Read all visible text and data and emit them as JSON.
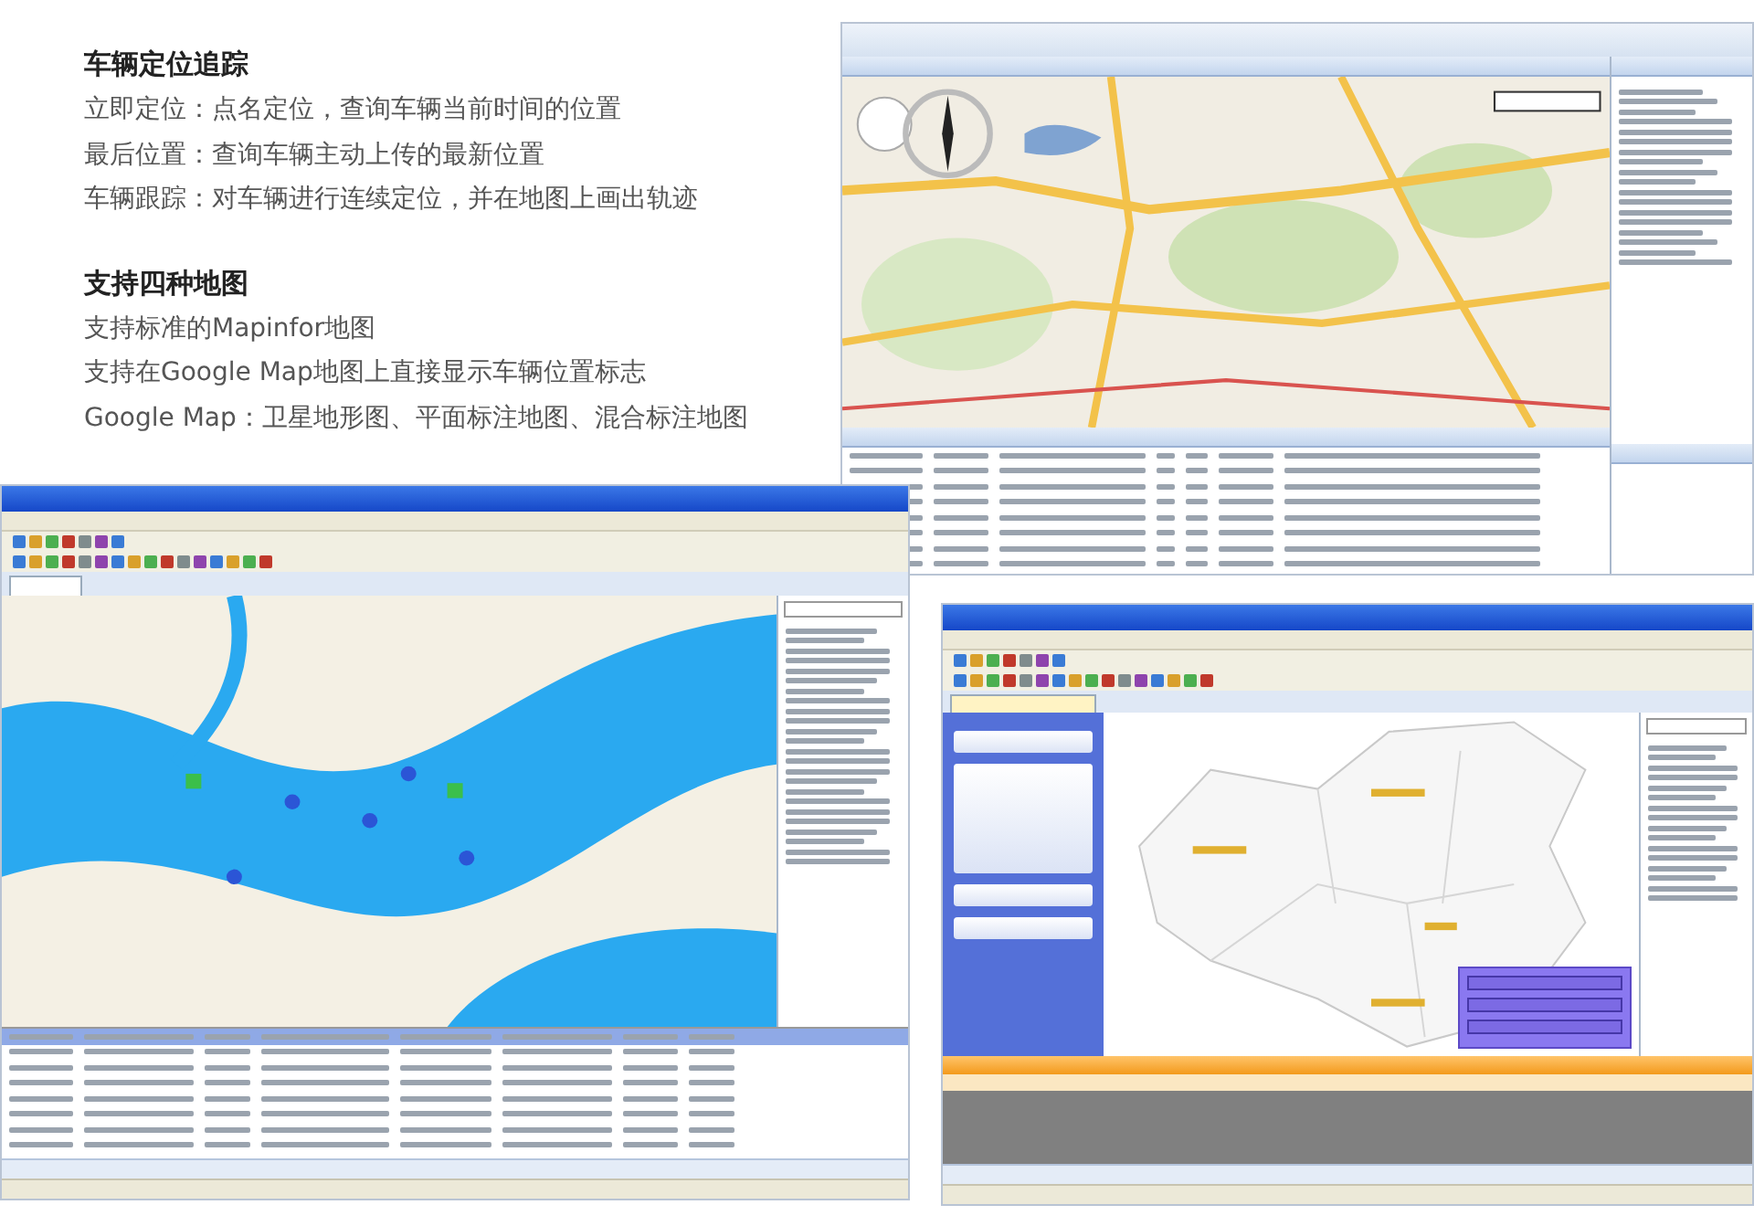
{
  "intro": {
    "sections": [
      {
        "heading": "车辆定位追踪",
        "lines": [
          "立即定位：点名定位，查询车辆当前时间的位置",
          "最后位置：查询车辆主动上传的最新位置",
          "车辆跟踪：对车辆进行连续定位，并在地图上画出轨迹"
        ]
      },
      {
        "heading": "支持四种地图",
        "lines": [
          "支持标准的Mapinfor地图",
          "支持在Google Map地图上直接显示车辆位置标志",
          "Google Map：卫星地形图、平面标注地图、混合标注地图"
        ]
      }
    ]
  },
  "screenshots": [
    {
      "kind": "web"
    },
    {
      "kind": "desktop"
    },
    {
      "kind": "playback"
    }
  ]
}
